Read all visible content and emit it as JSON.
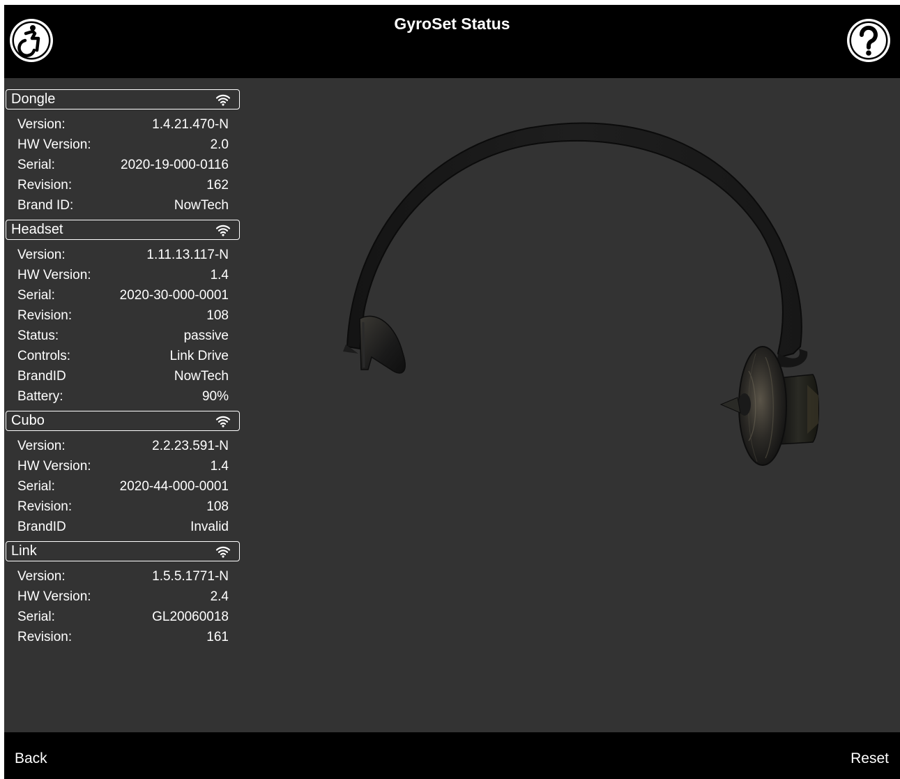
{
  "header": {
    "title": "GyroSet Status",
    "left_icon": "accessibility-icon",
    "right_icon": "help-question-icon"
  },
  "sections": [
    {
      "title": "Dongle",
      "icon": "wifi-icon",
      "rows": [
        {
          "label": "Version:",
          "value": "1.4.21.470-N"
        },
        {
          "label": "HW Version:",
          "value": "2.0"
        },
        {
          "label": "Serial:",
          "value": "2020-19-000-0116"
        },
        {
          "label": "Revision:",
          "value": "162"
        },
        {
          "label": "Brand ID:",
          "value": "NowTech"
        }
      ]
    },
    {
      "title": "Headset",
      "icon": "wifi-icon",
      "rows": [
        {
          "label": "Version:",
          "value": "1.11.13.117-N"
        },
        {
          "label": "HW Version:",
          "value": "1.4"
        },
        {
          "label": "Serial:",
          "value": "2020-30-000-0001"
        },
        {
          "label": "Revision:",
          "value": "108"
        },
        {
          "label": "Status:",
          "value": "passive"
        },
        {
          "label": "Controls:",
          "value": "Link Drive"
        },
        {
          "label": "BrandID",
          "value": "NowTech"
        },
        {
          "label": "Battery:",
          "value": "90%"
        }
      ]
    },
    {
      "title": "Cubo",
      "icon": "wifi-icon",
      "rows": [
        {
          "label": "Version:",
          "value": "2.2.23.591-N"
        },
        {
          "label": "HW Version:",
          "value": "1.4"
        },
        {
          "label": "Serial:",
          "value": "2020-44-000-0001"
        },
        {
          "label": "Revision:",
          "value": "108"
        },
        {
          "label": "BrandID",
          "value": "Invalid"
        }
      ]
    },
    {
      "title": "Link",
      "icon": "wifi-icon",
      "rows": [
        {
          "label": "Version:",
          "value": "1.5.5.1771-N"
        },
        {
          "label": "HW Version:",
          "value": "2.4"
        },
        {
          "label": "Serial:",
          "value": "GL20060018"
        },
        {
          "label": "Revision:",
          "value": "161"
        }
      ]
    }
  ],
  "viewport": {
    "model": "headset-3d-model"
  },
  "footer": {
    "back_label": "Back",
    "reset_label": "Reset"
  },
  "colors": {
    "bar_background": "#000000",
    "panel_background": "#333333",
    "text": "#ffffff"
  }
}
